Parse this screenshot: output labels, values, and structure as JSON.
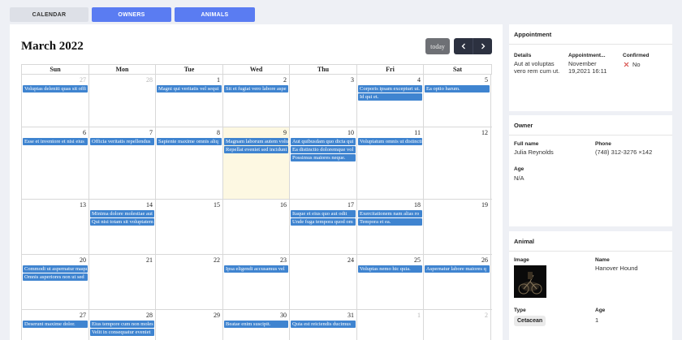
{
  "tabs": [
    "CALENDAR",
    "OWNERS",
    "ANIMALS"
  ],
  "calendar": {
    "title": "March 2022",
    "today_label": "today",
    "days_of_week": [
      "Sun",
      "Mon",
      "Tue",
      "Wed",
      "Thu",
      "Fri",
      "Sat"
    ],
    "weeks": [
      [
        {
          "d": "27",
          "other": true,
          "events": [
            "Voluptas deleniti quas sit offi"
          ]
        },
        {
          "d": "28",
          "other": true,
          "events": []
        },
        {
          "d": "1",
          "events": [
            "Magni qui veritatis vel sequi"
          ]
        },
        {
          "d": "2",
          "events": [
            "Sit et fugiat vero labore aspe"
          ]
        },
        {
          "d": "3",
          "events": []
        },
        {
          "d": "4",
          "events": [
            "Corporis ipsam excepturi ut.",
            "Id qui et."
          ]
        },
        {
          "d": "5",
          "events": [
            "Ea optio harum."
          ]
        }
      ],
      [
        {
          "d": "6",
          "events": [
            "Esse et inventore et nisi eius"
          ]
        },
        {
          "d": "7",
          "events": [
            "Officia veritatis repellendus"
          ]
        },
        {
          "d": "8",
          "events": [
            "Sapiente maxime omnis aliq"
          ]
        },
        {
          "d": "9",
          "today": true,
          "events": [
            "Magnam laborum autem volu",
            "Repellat eveniet sed incidunt"
          ]
        },
        {
          "d": "10",
          "events": [
            "Aut quibusdam quo dicta qui",
            "Ea distinctio doloremque vol",
            "Possimus maiores neque."
          ]
        },
        {
          "d": "11",
          "events": [
            "Voluptatum omnis ut distincti"
          ]
        },
        {
          "d": "12",
          "events": []
        }
      ],
      [
        {
          "d": "13",
          "events": []
        },
        {
          "d": "14",
          "events": [
            "Minima dolore molestiae aut",
            "Qui nisi totam sit voluptatem"
          ]
        },
        {
          "d": "15",
          "events": []
        },
        {
          "d": "16",
          "events": []
        },
        {
          "d": "17",
          "events": [
            "Itaque et eius quo aut odit",
            "Unde fuga tempora quod om"
          ]
        },
        {
          "d": "18",
          "events": [
            "Exercitationem nam alias ro",
            "Tempora et ea."
          ]
        },
        {
          "d": "19",
          "events": []
        }
      ],
      [
        {
          "d": "20",
          "events": [
            "Commodi ut aspernatur maqu",
            "Omnis asperiores non ut sed"
          ]
        },
        {
          "d": "21",
          "events": []
        },
        {
          "d": "22",
          "events": []
        },
        {
          "d": "23",
          "events": [
            "Ipsa eligendi accusamus vel"
          ]
        },
        {
          "d": "24",
          "events": []
        },
        {
          "d": "25",
          "events": [
            "Voluptas nemo hic quia."
          ]
        },
        {
          "d": "26",
          "events": [
            "Aspernatur labore maiores q"
          ]
        }
      ],
      [
        {
          "d": "27",
          "events": [
            "Deserunt maxime dolor."
          ]
        },
        {
          "d": "28",
          "events": [
            "Eius tempore cum non moles",
            "Velit in consequatur eveniet"
          ]
        },
        {
          "d": "29",
          "events": []
        },
        {
          "d": "30",
          "events": [
            "Beatae enim suscipit."
          ]
        },
        {
          "d": "31",
          "events": [
            "Quia est reiciendis ducimus"
          ]
        },
        {
          "d": "1",
          "other": true,
          "events": []
        },
        {
          "d": "2",
          "other": true,
          "events": []
        }
      ]
    ]
  },
  "appointment": {
    "header": "Appointment",
    "details_label": "Details",
    "details_value": "Aut at voluptas vero rem cum ut.",
    "time_label": "Appointment...",
    "time_value": "November 19,2021 16:11",
    "confirmed_label": "Confirmed",
    "confirmed_value": "No",
    "confirmed_color": "#d9534f"
  },
  "owner": {
    "header": "Owner",
    "fullname_label": "Full name",
    "fullname_value": "Julia Reynolds",
    "phone_label": "Phone",
    "phone_value": "(748) 312-3276 ×142",
    "age_label": "Age",
    "age_value": "N/A"
  },
  "animal": {
    "header": "Animal",
    "image_label": "Image",
    "name_label": "Name",
    "name_value": "Hanover Hound",
    "type_label": "Type",
    "type_value": "Cetacean",
    "age_label": "Age",
    "age_value": "1"
  },
  "colors": {
    "accent": "#5a7cf2",
    "event": "#3f84d0",
    "today_bg": "#fdf8e2",
    "nav_dark": "#2c3140"
  }
}
